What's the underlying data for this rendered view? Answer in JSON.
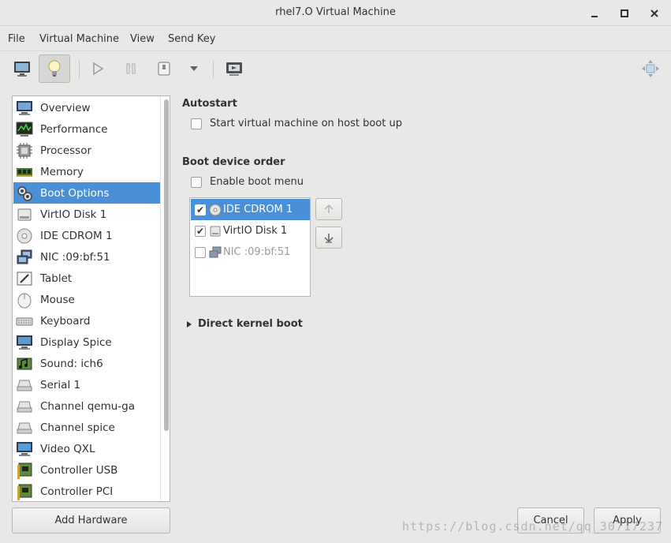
{
  "window": {
    "title": "rhel7.O Virtual Machine",
    "minimize": "_",
    "maximize": "□",
    "close": "×"
  },
  "menu": [
    "File",
    "Virtual Machine",
    "View",
    "Send Key"
  ],
  "toolbar": {
    "icons": [
      "monitor-icon",
      "lightbulb-icon",
      "play-icon",
      "pause-icon",
      "power-icon",
      "dropdown-arrow-icon",
      "snapshot-icon",
      "fullscreen-icon"
    ]
  },
  "sidebar": {
    "items": [
      {
        "label": "Overview",
        "icon": "overview-monitor-icon"
      },
      {
        "label": "Performance",
        "icon": "performance-graph-icon"
      },
      {
        "label": "Processor",
        "icon": "processor-chip-icon"
      },
      {
        "label": "Memory",
        "icon": "memory-module-icon"
      },
      {
        "label": "Boot Options",
        "icon": "gears-icon",
        "selected": true
      },
      {
        "label": "VirtIO Disk 1",
        "icon": "disk-icon"
      },
      {
        "label": "IDE CDROM 1",
        "icon": "cdrom-icon"
      },
      {
        "label": "NIC :09:bf:51",
        "icon": "network-icon"
      },
      {
        "label": "Tablet",
        "icon": "tablet-icon"
      },
      {
        "label": "Mouse",
        "icon": "mouse-icon"
      },
      {
        "label": "Keyboard",
        "icon": "keyboard-icon"
      },
      {
        "label": "Display Spice",
        "icon": "display-icon"
      },
      {
        "label": "Sound: ich6",
        "icon": "sound-icon"
      },
      {
        "label": "Serial 1",
        "icon": "serial-icon"
      },
      {
        "label": "Channel qemu-ga",
        "icon": "channel-icon"
      },
      {
        "label": "Channel spice",
        "icon": "channel-icon"
      },
      {
        "label": "Video QXL",
        "icon": "video-icon"
      },
      {
        "label": "Controller USB",
        "icon": "controller-icon"
      },
      {
        "label": "Controller PCI",
        "icon": "controller-icon"
      }
    ],
    "add_hardware": "Add Hardware"
  },
  "autostart": {
    "title": "Autostart",
    "checkbox_label": "Start virtual machine on host boot up",
    "checked": false
  },
  "boot_order": {
    "title": "Boot device order",
    "enable_menu_label": "Enable boot menu",
    "enable_menu_checked": false,
    "devices": [
      {
        "label": "IDE CDROM 1",
        "checked": true,
        "selected": true
      },
      {
        "label": "VirtIO Disk 1",
        "checked": true
      },
      {
        "label": "NIC :09:bf:51",
        "checked": false,
        "disabled": true
      }
    ]
  },
  "direct_kernel": {
    "label": "Direct kernel boot",
    "expanded": false
  },
  "buttons": {
    "cancel": "Cancel",
    "apply": "Apply"
  },
  "watermark": "https://blog.csdn.net/qq_30717237",
  "colors": {
    "selection": "#4a90d9",
    "background": "#e8e8e7"
  }
}
